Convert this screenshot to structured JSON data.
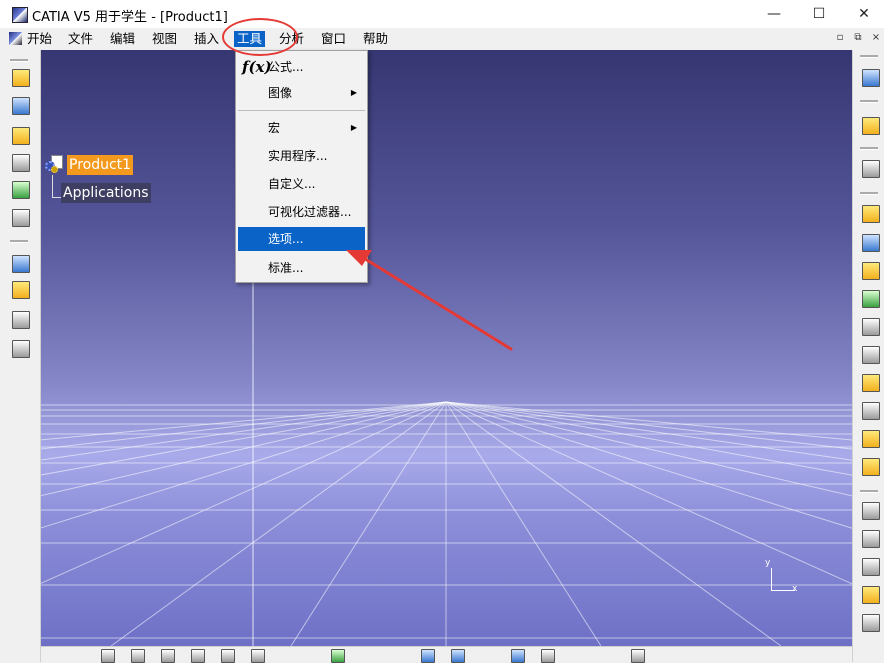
{
  "window": {
    "title": "CATIA V5 用于学生 - [Product1]",
    "minimize": "—",
    "maximize": "☐",
    "close": "✕"
  },
  "menubar": {
    "items": [
      {
        "name": "start",
        "label": "开始"
      },
      {
        "name": "file",
        "label": "文件"
      },
      {
        "name": "edit",
        "label": "编辑"
      },
      {
        "name": "view",
        "label": "视图"
      },
      {
        "name": "insert",
        "label": "插入"
      },
      {
        "name": "tools",
        "label": "工具",
        "active": true
      },
      {
        "name": "analysis",
        "label": "分析"
      },
      {
        "name": "window",
        "label": "窗口"
      },
      {
        "name": "help",
        "label": "帮助"
      }
    ],
    "mdi": {
      "minimize": "▫",
      "restore": "⧉",
      "close": "×"
    }
  },
  "tools_menu": {
    "items": [
      {
        "name": "formula",
        "label": "公式...",
        "icon": "fx-icon"
      },
      {
        "name": "image",
        "label": "图像",
        "submenu": true
      },
      {
        "name": "macro",
        "label": "宏",
        "submenu": true
      },
      {
        "name": "utility",
        "label": "实用程序..."
      },
      {
        "name": "customize",
        "label": "自定义..."
      },
      {
        "name": "visual-filter",
        "label": "可视化过滤器..."
      },
      {
        "name": "options",
        "label": "选项...",
        "selected": true
      },
      {
        "name": "standards",
        "label": "标准..."
      }
    ],
    "submenu_arrow": "▶"
  },
  "tree": {
    "root": "Product1",
    "child": "Applications"
  },
  "compass": {
    "x_label": "x",
    "y_label": "y"
  },
  "colors": {
    "accent": "#0a64c8",
    "tree_highlight": "#f39a1e",
    "annotation_red": "#e53935"
  }
}
